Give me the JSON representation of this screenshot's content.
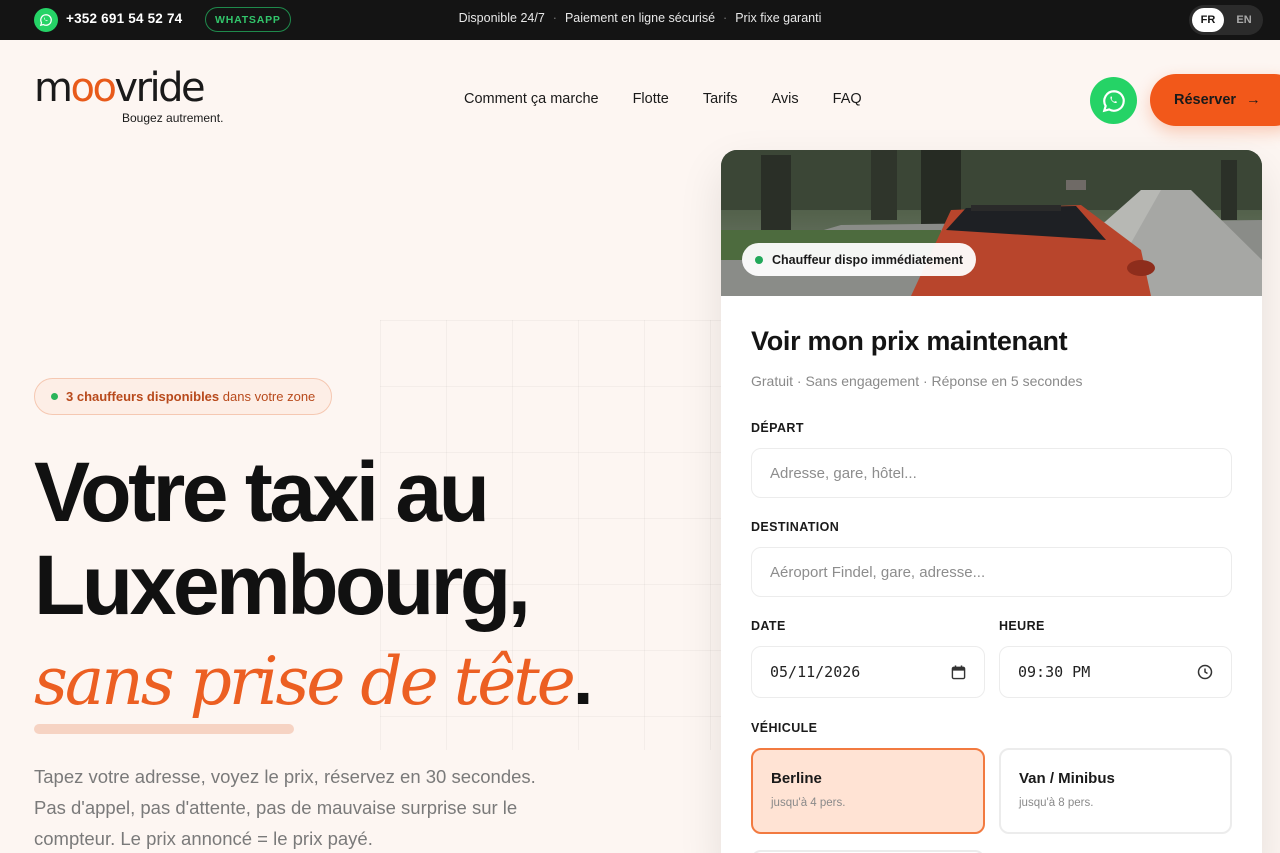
{
  "topbar": {
    "phone": "+352 691 54 52 74",
    "whatsapp_badge": "WHATSAPP",
    "highlights": [
      "Disponible 24/7",
      "Paiement en ligne sécurisé",
      "Prix fixe garanti"
    ],
    "separator": "·",
    "languages": [
      {
        "code": "FR",
        "active": true
      },
      {
        "code": "EN",
        "active": false
      }
    ]
  },
  "header": {
    "logo_pre": "m",
    "logo_accent": "oo",
    "logo_post": "vride",
    "tagline": "Bougez autrement.",
    "nav": [
      "Comment ça marche",
      "Flotte",
      "Tarifs",
      "Avis",
      "FAQ"
    ],
    "reserve_label": "Réserver",
    "reserve_arrow": "→"
  },
  "hero": {
    "availability_strong": "3 chauffeurs disponibles",
    "availability_rest": "dans votre zone",
    "title_line1": "Votre taxi au",
    "title_line2": "Luxembourg,",
    "title_accent": "sans prise de tête",
    "title_period": ".",
    "lead": "Tapez votre adresse, voyez le prix, réservez en 30 secondes. Pas d'appel, pas d'attente, pas de mauvaise surprise sur le compteur. Le prix annoncé = le prix payé."
  },
  "booking": {
    "photo_badge": "Chauffeur dispo immédiatement",
    "title": "Voir mon prix maintenant",
    "subtitle": "Gratuit · Sans engagement · Réponse en 5 secondes",
    "departure": {
      "label": "DÉPART",
      "placeholder": "Adresse, gare, hôtel..."
    },
    "destination": {
      "label": "DESTINATION",
      "placeholder": "Aéroport Findel, gare, adresse..."
    },
    "date": {
      "label": "DATE",
      "value": "05/11/2026"
    },
    "time": {
      "label": "HEURE",
      "value": "09:30 PM"
    },
    "vehicle_label": "VÉHICULE",
    "vehicles": [
      {
        "name": "Berline",
        "capacity": "jusqu'à 4 pers.",
        "selected": true
      },
      {
        "name": "Van / Minibus",
        "capacity": "jusqu'à 8 pers.",
        "selected": false
      }
    ]
  },
  "colors": {
    "accent": "#f2581a",
    "whatsapp": "#25d366",
    "topbar": "#141414",
    "selected_vehicle_bg": "#ffe3d4",
    "status_green": "#22a85a"
  },
  "icons": [
    "whatsapp-icon",
    "arrow-right-icon",
    "calendar-icon",
    "clock-icon"
  ]
}
